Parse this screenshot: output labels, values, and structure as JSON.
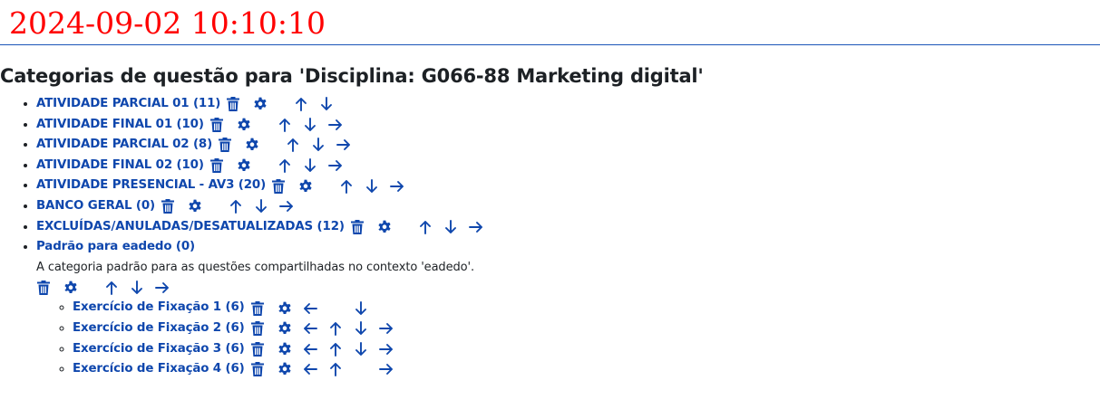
{
  "timestamp": "2024-09-02 10:10:10",
  "heading": "Categorias de questão para 'Disciplina: G066-88 Marketing digital'",
  "categories": [
    {
      "label": "ATIVIDADE PARCIAL 01 (11)",
      "actions": [
        "delete",
        "edit",
        "move-up",
        "move-down"
      ]
    },
    {
      "label": "ATIVIDADE FINAL 01 (10)",
      "actions": [
        "delete",
        "edit",
        "move-up",
        "move-down",
        "move-right"
      ]
    },
    {
      "label": "ATIVIDADE PARCIAL 02 (8)",
      "actions": [
        "delete",
        "edit",
        "move-up",
        "move-down",
        "move-right"
      ]
    },
    {
      "label": "ATIVIDADE FINAL 02 (10)",
      "actions": [
        "delete",
        "edit",
        "move-up",
        "move-down",
        "move-right"
      ]
    },
    {
      "label": "ATIVIDADE PRESENCIAL - AV3 (20)",
      "actions": [
        "delete",
        "edit",
        "move-up",
        "move-down",
        "move-right"
      ]
    },
    {
      "label": "BANCO GERAL (0)",
      "actions": [
        "delete",
        "edit",
        "move-up",
        "move-down",
        "move-right"
      ]
    },
    {
      "label": "EXCLUÍDAS/ANULADAS/DESATUALIZADAS (12)",
      "actions": [
        "delete",
        "edit",
        "move-up",
        "move-down",
        "move-right"
      ]
    },
    {
      "label": "Padrão para eadedo (0)",
      "description": "A categoria padrão para as questões compartilhadas no contexto 'eadedo'.",
      "actions": [
        "delete",
        "edit",
        "move-up",
        "move-down",
        "move-right"
      ],
      "children": [
        {
          "label": "Exercício de Fixação 1 (6)",
          "actions": [
            "delete",
            "edit",
            "move-left",
            "move-down"
          ]
        },
        {
          "label": "Exercício de Fixação 2 (6)",
          "actions": [
            "delete",
            "edit",
            "move-left",
            "move-up",
            "move-down",
            "move-right"
          ]
        },
        {
          "label": "Exercício de Fixação 3 (6)",
          "actions": [
            "delete",
            "edit",
            "move-left",
            "move-up",
            "move-down",
            "move-right"
          ]
        },
        {
          "label": "Exercício de Fixação 4 (6)",
          "actions": [
            "delete",
            "edit",
            "move-left",
            "move-up",
            "move-right"
          ]
        }
      ]
    }
  ],
  "icons": {
    "delete": "trash-icon",
    "edit": "gear-icon",
    "move-left": "arrow-left-icon",
    "move-up": "arrow-up-icon",
    "move-down": "arrow-down-icon",
    "move-right": "arrow-right-icon"
  },
  "colors": {
    "timestamp": "#ff0000",
    "link": "#0f47ad",
    "rule": "#1a55b8",
    "text": "#1d2125"
  }
}
